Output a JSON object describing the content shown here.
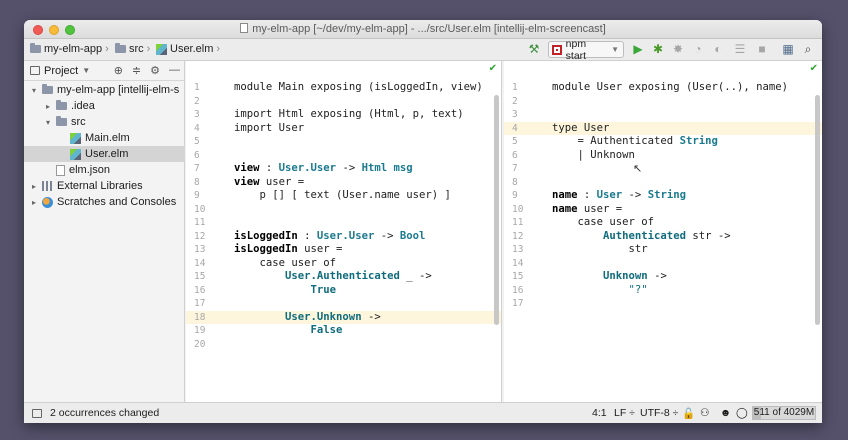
{
  "window": {
    "title": "my-elm-app [~/dev/my-elm-app] - .../src/User.elm [intellij-elm-screencast]"
  },
  "navbar": {
    "breadcrumbs": [
      "my-elm-app",
      "src",
      "User.elm"
    ],
    "run_config": "npm start",
    "icons": [
      "hammer-icon",
      "run-icon",
      "debug-icon",
      "coverage-icon",
      "profile-icon",
      "concurrency-icon",
      "attach-icon",
      "stop-icon",
      "project-structure-icon",
      "search-icon"
    ]
  },
  "project_panel": {
    "title": "Project",
    "tree": [
      {
        "label": "my-elm-app [intellij-elm-s",
        "indent": 0,
        "arrow": "▾",
        "icon": "folder"
      },
      {
        "label": ".idea",
        "indent": 1,
        "arrow": "▸",
        "icon": "folder"
      },
      {
        "label": "src",
        "indent": 1,
        "arrow": "▾",
        "icon": "folder"
      },
      {
        "label": "Main.elm",
        "indent": 2,
        "arrow": "",
        "icon": "elm"
      },
      {
        "label": "User.elm",
        "indent": 2,
        "arrow": "",
        "icon": "elm",
        "selected": true
      },
      {
        "label": "elm.json",
        "indent": 1,
        "arrow": "",
        "icon": "json"
      },
      {
        "label": "External Libraries",
        "indent": 0,
        "arrow": "▸",
        "icon": "lib"
      },
      {
        "label": "Scratches and Consoles",
        "indent": 0,
        "arrow": "▸",
        "icon": "scratch"
      }
    ]
  },
  "editor_left": {
    "file": "Main.elm",
    "lines": [
      {
        "n": "1",
        "tokens": [
          [
            "kw",
            "module "
          ],
          [
            "",
            "Main "
          ],
          [
            "kw",
            "exposing "
          ],
          [
            "",
            "(isLoggedIn, view)"
          ]
        ]
      },
      {
        "n": "2",
        "tokens": []
      },
      {
        "n": "3",
        "tokens": [
          [
            "kw",
            "import "
          ],
          [
            "",
            "Html "
          ],
          [
            "kw",
            "exposing "
          ],
          [
            "",
            "(Html, p, text)"
          ]
        ]
      },
      {
        "n": "4",
        "tokens": [
          [
            "kw",
            "import "
          ],
          [
            "",
            "User"
          ]
        ]
      },
      {
        "n": "5",
        "tokens": []
      },
      {
        "n": "6",
        "tokens": []
      },
      {
        "n": "7",
        "tokens": [
          [
            "fn",
            "view"
          ],
          [
            "",
            " : "
          ],
          [
            "ty",
            "User.User"
          ],
          [
            "",
            " -> "
          ],
          [
            "ty",
            "Html msg"
          ]
        ]
      },
      {
        "n": "8",
        "tokens": [
          [
            "fn",
            "view"
          ],
          [
            "",
            " user ="
          ]
        ]
      },
      {
        "n": "9",
        "tokens": [
          [
            "",
            "    p [] [ text (User.name user) ]"
          ]
        ]
      },
      {
        "n": "10",
        "tokens": []
      },
      {
        "n": "11",
        "tokens": []
      },
      {
        "n": "12",
        "tokens": [
          [
            "fn",
            "isLoggedIn"
          ],
          [
            "",
            " : "
          ],
          [
            "ty",
            "User.User"
          ],
          [
            "",
            " -> "
          ],
          [
            "ty",
            "Bool"
          ]
        ]
      },
      {
        "n": "13",
        "tokens": [
          [
            "fn",
            "isLoggedIn"
          ],
          [
            "",
            " user ="
          ]
        ]
      },
      {
        "n": "14",
        "tokens": [
          [
            "",
            "    "
          ],
          [
            "kw",
            "case "
          ],
          [
            "",
            "user "
          ],
          [
            "kw",
            "of"
          ]
        ]
      },
      {
        "n": "15",
        "tokens": [
          [
            "",
            "        "
          ],
          [
            "ctor",
            "User.Authenticated"
          ],
          [
            "",
            " _ ->"
          ]
        ]
      },
      {
        "n": "16",
        "tokens": [
          [
            "",
            "            "
          ],
          [
            "ctor",
            "True"
          ]
        ]
      },
      {
        "n": "17",
        "tokens": []
      },
      {
        "n": "18",
        "tokens": [
          [
            "",
            "        "
          ],
          [
            "ctor",
            "User.Unknown"
          ],
          [
            "",
            " ->"
          ]
        ],
        "hl": true
      },
      {
        "n": "19",
        "tokens": [
          [
            "",
            "            "
          ],
          [
            "ctor",
            "False"
          ]
        ]
      },
      {
        "n": "20",
        "tokens": []
      }
    ]
  },
  "editor_right": {
    "file": "User.elm",
    "lines": [
      {
        "n": "1",
        "tokens": [
          [
            "kw",
            "module "
          ],
          [
            "",
            "User "
          ],
          [
            "kw",
            "exposing "
          ],
          [
            "",
            "(User(..), name)"
          ]
        ]
      },
      {
        "n": "2",
        "tokens": []
      },
      {
        "n": "3",
        "tokens": []
      },
      {
        "n": "4",
        "tokens": [
          [
            "kw",
            "type "
          ],
          [
            "",
            "User"
          ]
        ],
        "hl": true
      },
      {
        "n": "5",
        "tokens": [
          [
            "",
            "    = Authenticated "
          ],
          [
            "ty",
            "String"
          ]
        ]
      },
      {
        "n": "6",
        "tokens": [
          [
            "",
            "    | Unknown"
          ]
        ]
      },
      {
        "n": "7",
        "tokens": []
      },
      {
        "n": "8",
        "tokens": []
      },
      {
        "n": "9",
        "tokens": [
          [
            "fn",
            "name"
          ],
          [
            "",
            " : "
          ],
          [
            "ty",
            "User"
          ],
          [
            "",
            " -> "
          ],
          [
            "ty",
            "String"
          ]
        ]
      },
      {
        "n": "10",
        "tokens": [
          [
            "fn",
            "name"
          ],
          [
            "",
            " user ="
          ]
        ]
      },
      {
        "n": "11",
        "tokens": [
          [
            "",
            "    "
          ],
          [
            "kw",
            "case "
          ],
          [
            "",
            "user "
          ],
          [
            "kw",
            "of"
          ]
        ]
      },
      {
        "n": "12",
        "tokens": [
          [
            "",
            "        "
          ],
          [
            "ctor",
            "Authenticated"
          ],
          [
            "",
            " str ->"
          ]
        ]
      },
      {
        "n": "13",
        "tokens": [
          [
            "",
            "            str"
          ]
        ]
      },
      {
        "n": "14",
        "tokens": []
      },
      {
        "n": "15",
        "tokens": [
          [
            "",
            "        "
          ],
          [
            "ctor",
            "Unknown"
          ],
          [
            "",
            " ->"
          ]
        ]
      },
      {
        "n": "16",
        "tokens": [
          [
            "",
            "            "
          ],
          [
            "str",
            "\"?\""
          ]
        ]
      },
      {
        "n": "17",
        "tokens": []
      }
    ]
  },
  "statusbar": {
    "message": "2 occurrences changed",
    "position": "4:1",
    "line_sep": "LF ÷",
    "encoding": "UTF-8 ÷",
    "memory": "511 of 4029M",
    "memory_fraction": 0.127
  }
}
